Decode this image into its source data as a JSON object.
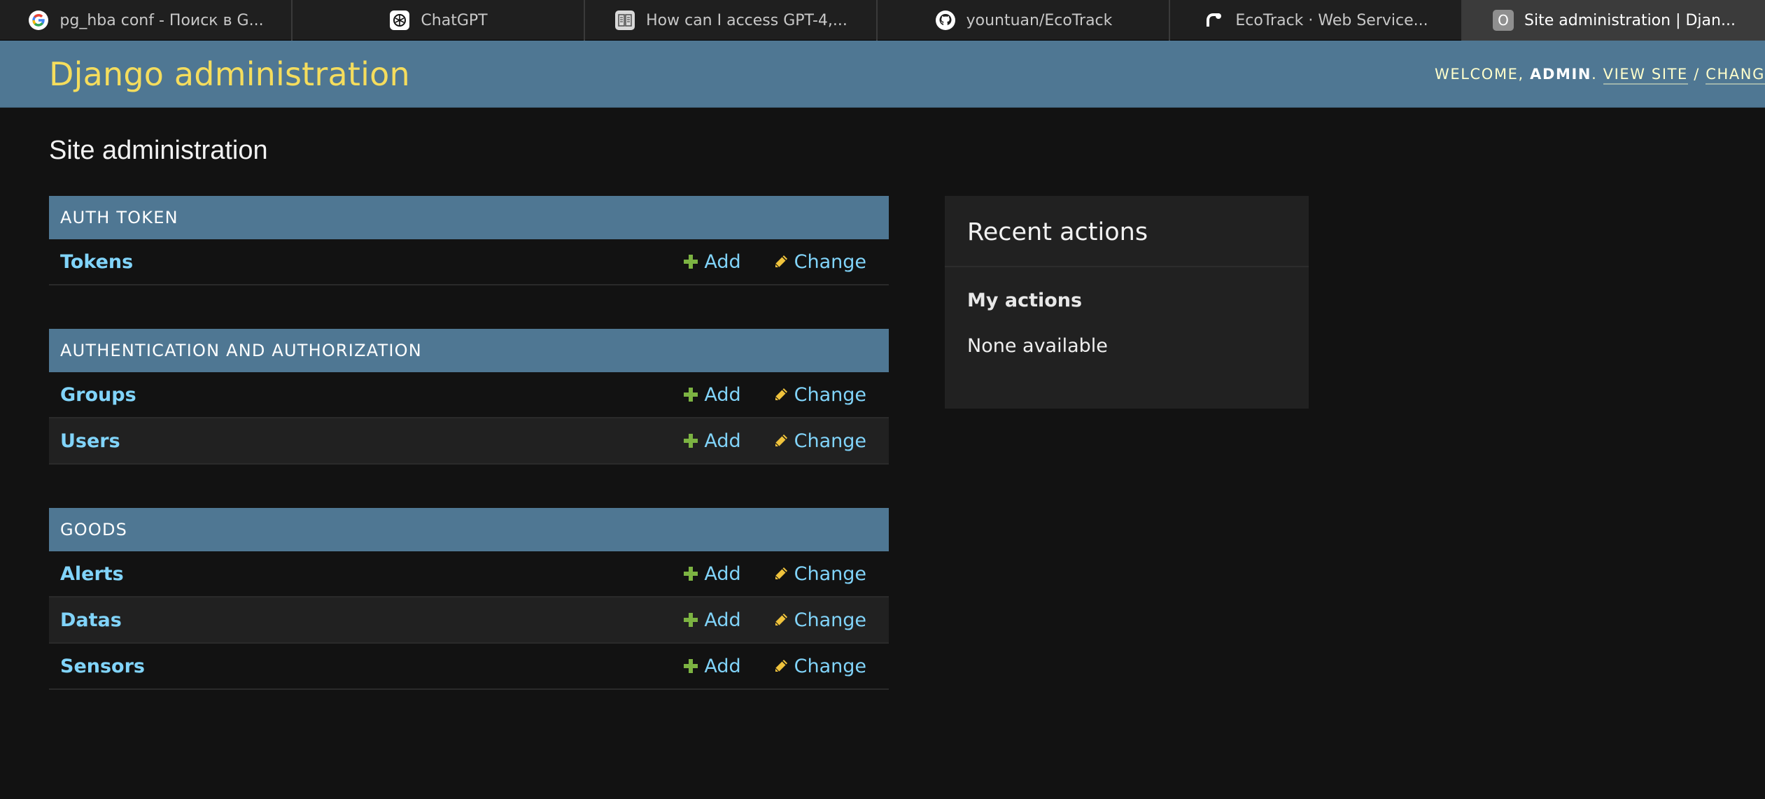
{
  "browser": {
    "tabs": [
      {
        "label": "pg_hba conf - Поиск в G...",
        "icon": "google-icon",
        "active": false
      },
      {
        "label": "ChatGPT",
        "icon": "chatgpt-icon",
        "active": false
      },
      {
        "label": "How can I access GPT-4,...",
        "icon": "reader-icon",
        "active": false
      },
      {
        "label": "yountuan/EcoTrack",
        "icon": "github-icon",
        "active": false
      },
      {
        "label": "EcoTrack · Web Service...",
        "icon": "render-icon",
        "active": false
      },
      {
        "label": "Site administration | Djan...",
        "icon": "o-letter-icon",
        "active": true
      }
    ]
  },
  "header": {
    "branding": "Django administration",
    "welcome": "Welcome,",
    "user": "admin",
    "view_site": "View site",
    "separator": "/",
    "change_password": "Chang"
  },
  "page": {
    "title": "Site administration"
  },
  "modules": [
    {
      "caption": "Auth Token",
      "models": [
        {
          "name": "Tokens",
          "add": "Add",
          "change": "Change"
        }
      ]
    },
    {
      "caption": "Authentication and Authorization",
      "models": [
        {
          "name": "Groups",
          "add": "Add",
          "change": "Change"
        },
        {
          "name": "Users",
          "add": "Add",
          "change": "Change"
        }
      ]
    },
    {
      "caption": "Goods",
      "models": [
        {
          "name": "Alerts",
          "add": "Add",
          "change": "Change"
        },
        {
          "name": "Datas",
          "add": "Add",
          "change": "Change"
        },
        {
          "name": "Sensors",
          "add": "Add",
          "change": "Change"
        }
      ]
    }
  ],
  "recent_actions": {
    "title": "Recent actions",
    "subtitle": "My actions",
    "empty": "None available"
  },
  "colors": {
    "header_bg": "#4f7793",
    "branding": "#f5dd5d",
    "link": "#81d4fa",
    "add_icon": "#7cb342",
    "change_icon": "#f0c33c",
    "background": "#121212"
  }
}
